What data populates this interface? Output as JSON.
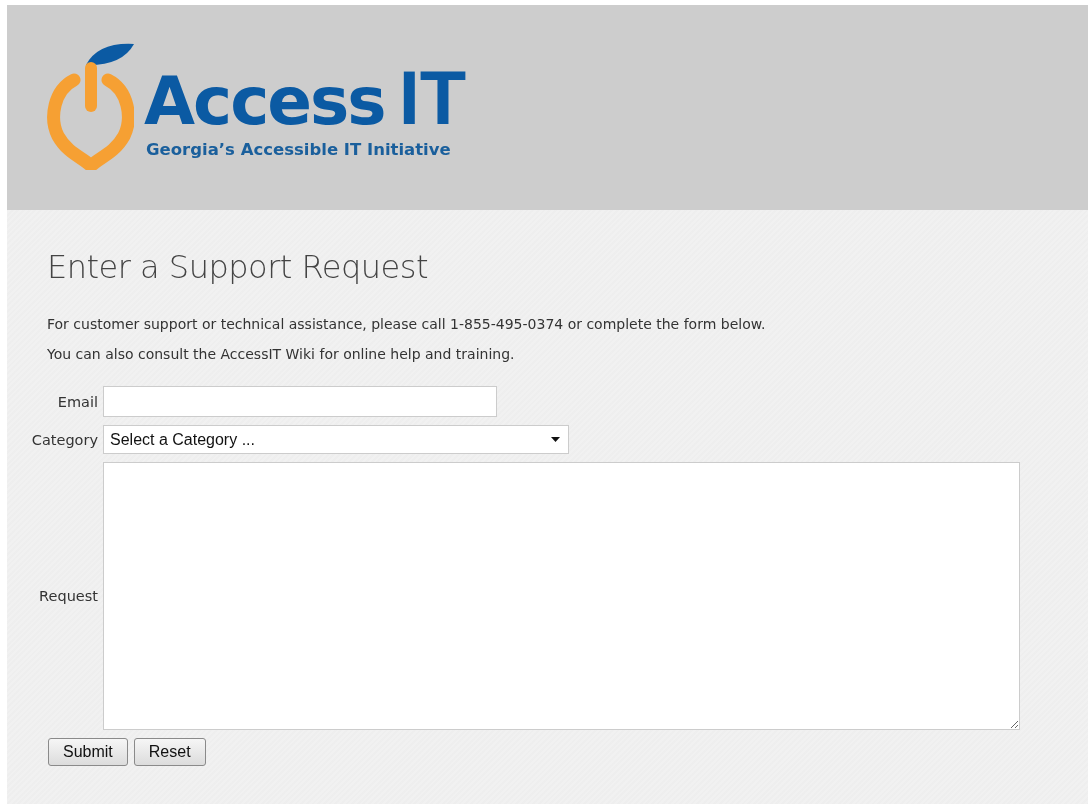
{
  "logo": {
    "word": "Access",
    "word_bold": "IT",
    "tagline": "Georgia’s Accessible IT Initiative"
  },
  "heading": "Enter a Support Request",
  "intro": [
    "For customer support or technical assistance, please call 1-855-495-0374 or complete the form below.",
    "You can also consult the AccessIT Wiki for online help and training."
  ],
  "form": {
    "email": {
      "label": "Email"
    },
    "category": {
      "label": "Category",
      "value": "Select a Category ..."
    },
    "request": {
      "label": "Request"
    },
    "buttons": [
      "Submit",
      "Reset"
    ]
  }
}
